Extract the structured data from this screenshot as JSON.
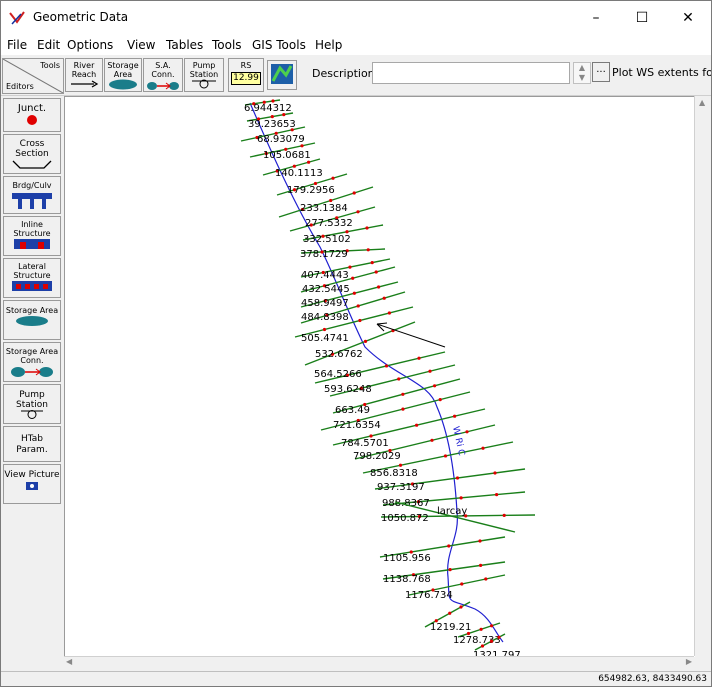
{
  "window": {
    "title": "Geometric Data",
    "controls": {
      "minimize": "–",
      "maximize": "☐",
      "close": "✕"
    }
  },
  "menu": [
    "File",
    "Edit",
    "Options",
    "View",
    "Tables",
    "Tools",
    "GIS Tools",
    "Help"
  ],
  "toolbar": {
    "tabs_tools": "Tools",
    "tabs_editors": "Editors",
    "river_reach": "River Reach",
    "storage_area": "Storage Area",
    "sa_conn": "S.A. Conn.",
    "pump_station": "Pump Station",
    "rs_label": "RS",
    "rs_value": "12.99",
    "description_label": "Description :",
    "description_value": "",
    "dots_label": "...",
    "plot_ws": "Plot WS extents for P"
  },
  "sidebar": [
    {
      "id": "junct",
      "label": "Junct."
    },
    {
      "id": "cross-section",
      "label": "Cross Section"
    },
    {
      "id": "brdg-culv",
      "label": "Brdg/Culv"
    },
    {
      "id": "inline-structure",
      "label": "Inline Structure"
    },
    {
      "id": "lateral-structure",
      "label": "Lateral Structure"
    },
    {
      "id": "storage-area",
      "label": "Storage Area"
    },
    {
      "id": "storage-area-conn",
      "label": "Storage Area Conn."
    },
    {
      "id": "pump-station",
      "label": "Pump Station"
    },
    {
      "id": "htab-param",
      "label": "HTab Param."
    },
    {
      "id": "view-picture",
      "label": "View Picture"
    }
  ],
  "river_label": "larcay",
  "stream_label": "W Ri C",
  "cross_sections": [
    "6.944312",
    "39.23653",
    "68.93079",
    "105.0681",
    "140.1113",
    "179.2956",
    "233.1384",
    "277.5332",
    "332.5102",
    "378.1729",
    "407.4443",
    "432.5445",
    "458.9497",
    "484.8398",
    "505.4741",
    "532.6762",
    "564.5266",
    "593.6248",
    "663.49",
    "721.6354",
    "784.5701",
    "798.2029",
    "856.8318",
    "937.3197",
    "988.8367",
    "1050.872",
    "1105.956",
    "1138.768",
    "1176.734",
    "1219.21",
    "1278.733",
    "1321.797"
  ],
  "status": {
    "coordinates": "654982.63, 8433490.63"
  },
  "colors": {
    "xs_line": "#1a7f1a",
    "river": "#2020d0",
    "bank_point": "#e00000",
    "label": "#000000"
  }
}
